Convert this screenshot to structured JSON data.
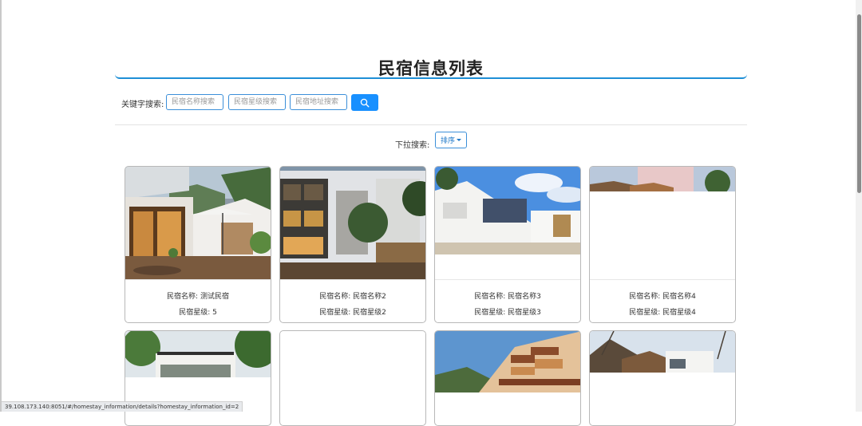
{
  "page": {
    "title": "民宿信息列表"
  },
  "search": {
    "label": "关键字搜索:",
    "name_placeholder": "民宿名称搜索",
    "star_placeholder": "民宿星级搜索",
    "address_placeholder": "民宿地址搜索",
    "button_icon": "search-icon"
  },
  "filter": {
    "label": "下拉搜索:",
    "sort_label": "排序"
  },
  "cards": [
    {
      "name_line": "民宿名称: 测试民宿",
      "star_line": "民宿星级: 5"
    },
    {
      "name_line": "民宿名称: 民宿名称2",
      "star_line": "民宿星级: 民宿星级2"
    },
    {
      "name_line": "民宿名称: 民宿名称3",
      "star_line": "民宿星级: 民宿星级3"
    },
    {
      "name_line": "民宿名称: 民宿名称4",
      "star_line": "民宿星级: 民宿星级4"
    }
  ],
  "status_bar": {
    "url": "39.108.173.140:8051/#/homestay_information/details?homestay_information_id=2"
  },
  "colors": {
    "accent": "#1890ff",
    "title_underline": "#1e8fd6"
  }
}
